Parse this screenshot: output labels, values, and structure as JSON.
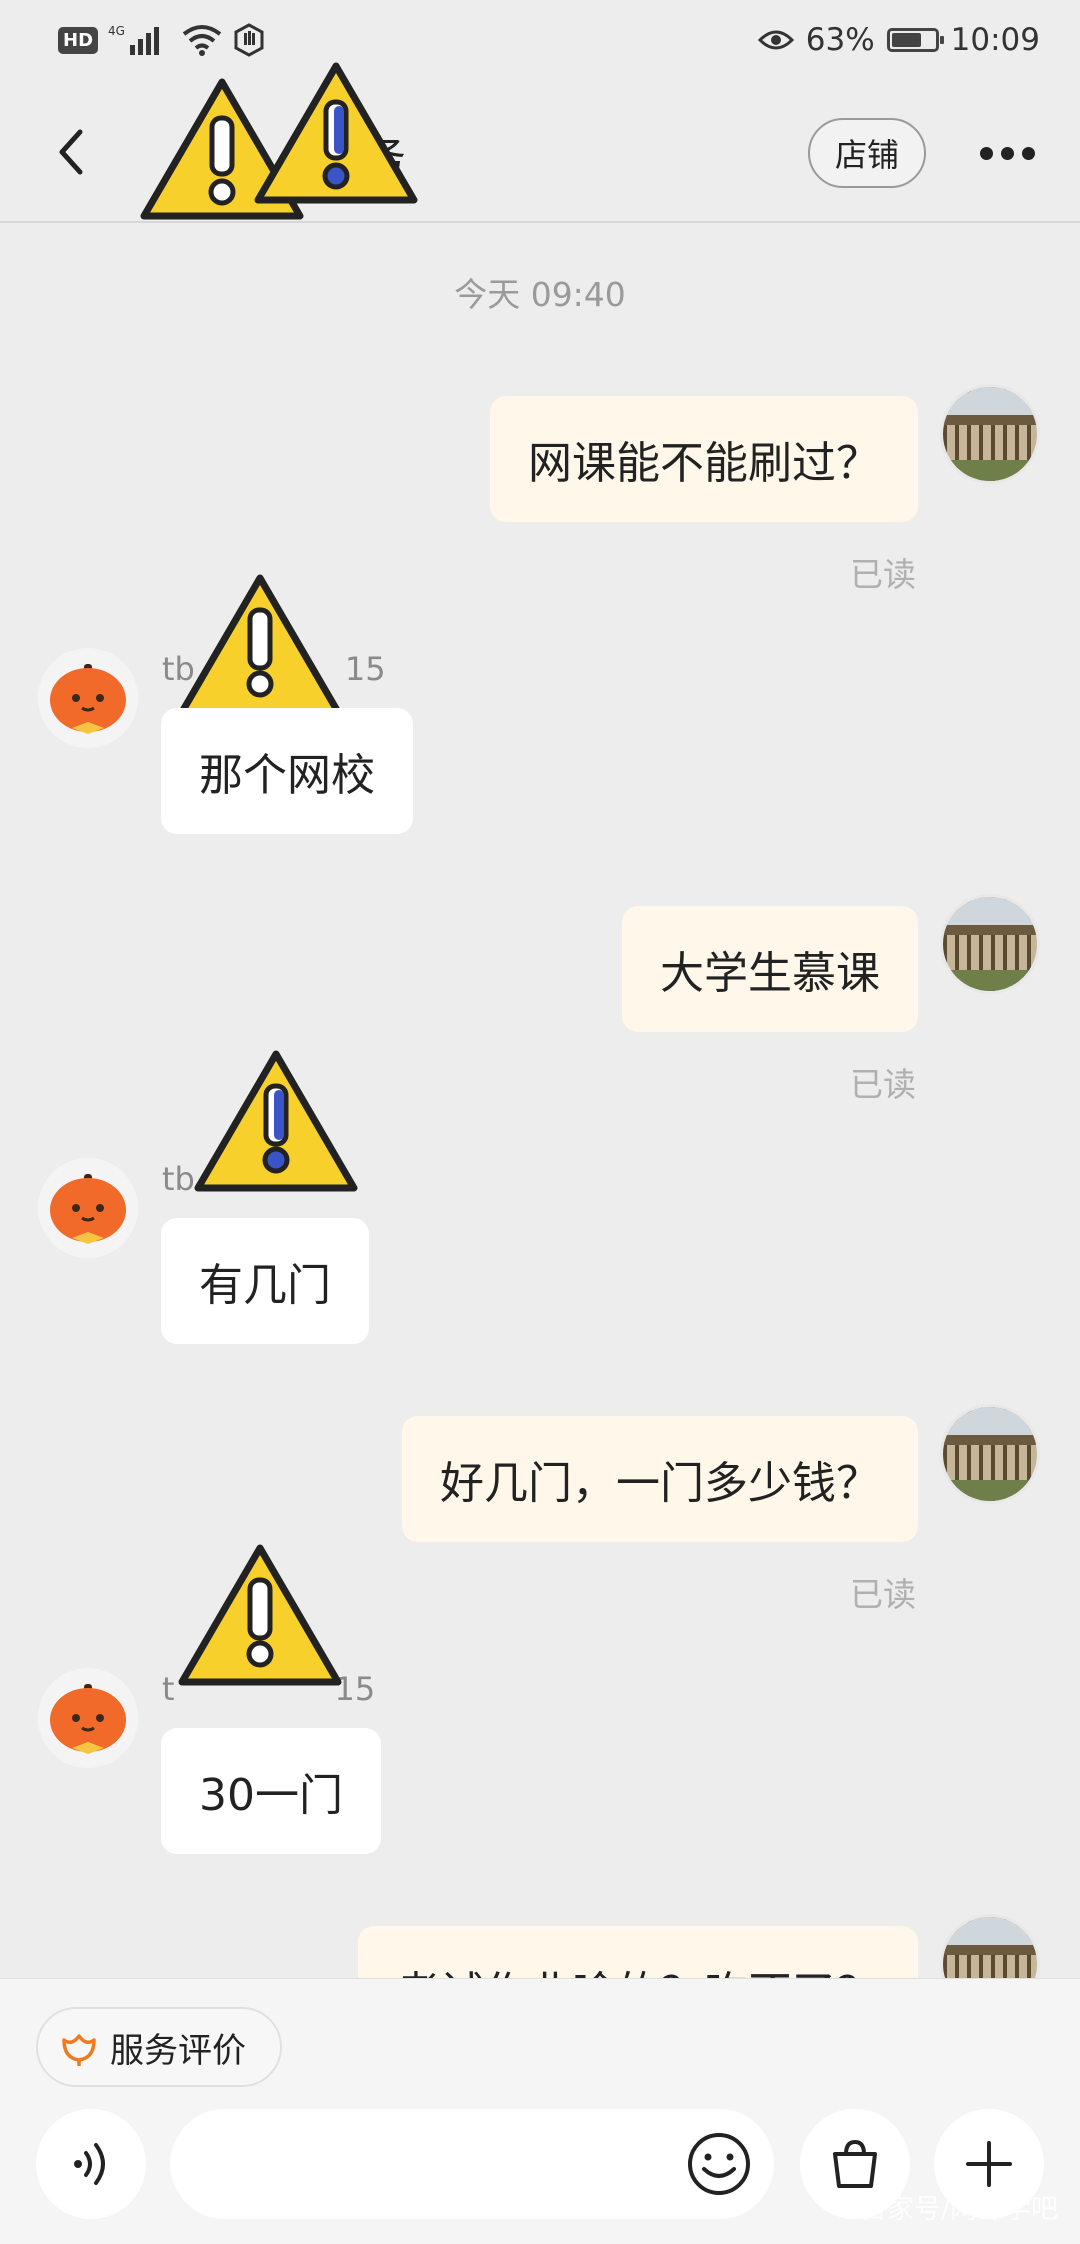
{
  "status_bar": {
    "hd": "HD",
    "network": "4G",
    "battery_pct": "63%",
    "battery_level": 0.63,
    "time": "10:09"
  },
  "header": {
    "title_visible": "务",
    "shop_label": "店铺"
  },
  "time_divider": "今天  09:40",
  "messages": [
    {
      "side": "out",
      "text": "网课能不能刷过？",
      "status": "已读"
    },
    {
      "side": "in",
      "sender_visible": "tb",
      "sender_suffix": "15",
      "text": "那个网校"
    },
    {
      "side": "out",
      "text": "大学生慕课",
      "status": "已读"
    },
    {
      "side": "in",
      "sender_visible": "tb",
      "text": "有几门"
    },
    {
      "side": "out",
      "text": "好几门，一门多少钱？",
      "status": "已读"
    },
    {
      "side": "in",
      "sender_visible": "t",
      "sender_suffix": "15",
      "text": "30一门"
    },
    {
      "side": "out",
      "text": "考试作业啥的？吃不了？"
    }
  ],
  "bottom_bar": {
    "rate_label": "服务评价",
    "input_placeholder": "",
    "watermark": "百家号/网课学吧"
  },
  "colors": {
    "background": "#ededed",
    "out_bubble": "#fff7ea",
    "in_bubble": "#ffffff",
    "warning_yellow": "#f7d02c",
    "avatar_orange": "#f26a2a"
  }
}
